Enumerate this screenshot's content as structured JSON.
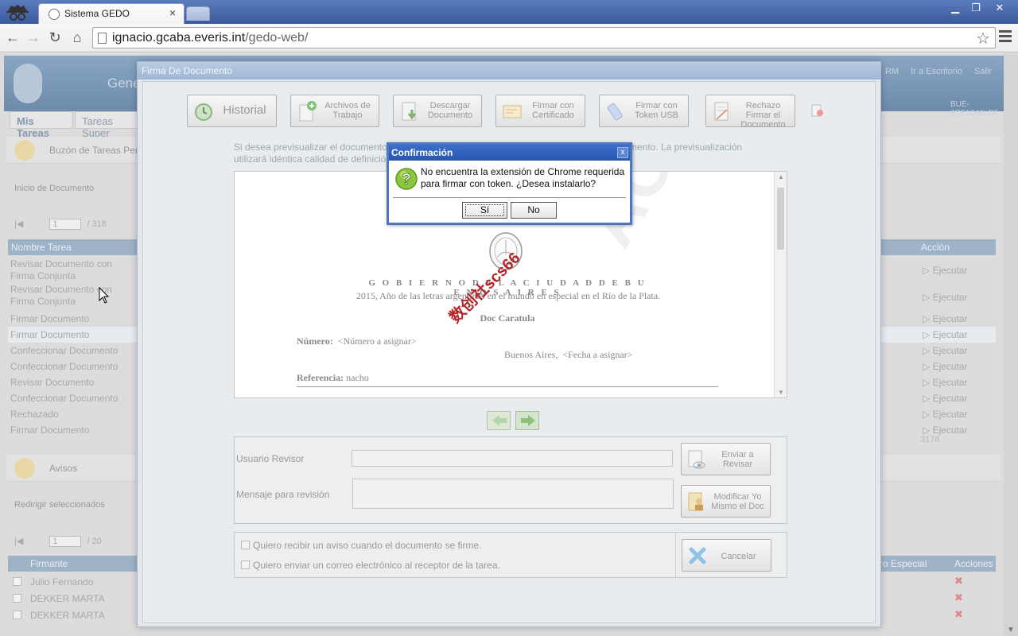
{
  "browser": {
    "tab_title": "Sistema GEDO",
    "tab_close": "×",
    "url_host": "ignacio.gcaba.everis.int",
    "url_path": "/gedo-web/",
    "win_min": "▁",
    "win_max": "❐",
    "win_close": "✕"
  },
  "app": {
    "title": "Gene",
    "user_links": [
      "RM",
      "Ir a Escritorio",
      "Salir"
    ],
    "user_code": "BUE-2CE1040LDF",
    "tabs": [
      "Mis Tareas",
      "Tareas Super"
    ],
    "buzon_title": "Buzón de Tareas Pen",
    "inicio_link": "Inicio de Documento",
    "pager1": {
      "page": "1",
      "of": "/ 318"
    },
    "task_columns": {
      "name": "Nombre Tarea",
      "action": "Acción"
    },
    "tasks": [
      {
        "name": "Revisar Documento con Firma Conjunta",
        "action": "Ejecutar"
      },
      {
        "name": "Revisar Documento con Firma Conjunta",
        "action": "Ejecutar"
      },
      {
        "name": "Firmar Documento",
        "action": "Ejecutar"
      },
      {
        "name": "Firmar Documento",
        "action": "Ejecutar"
      },
      {
        "name": "Confeccionar Documento",
        "action": "Ejecutar"
      },
      {
        "name": "Confeccionar Documento",
        "action": "Ejecutar"
      },
      {
        "name": "Revisar Documento",
        "action": "Ejecutar"
      },
      {
        "name": "Confeccionar Documento",
        "action": "Ejecutar"
      },
      {
        "name": "Rechazado",
        "action": "Ejecutar"
      },
      {
        "name": "Firmar Documento",
        "action": "Ejecutar"
      }
    ],
    "task_total": "3178",
    "avisos_title": "Avisos",
    "redirigir": "Redirigir seleccionados",
    "pager2": {
      "page": "1",
      "of": "/ 20"
    },
    "sign_columns": {
      "firmante": "Firmante",
      "especial": "ro Especial",
      "acciones": "Acciones"
    },
    "signers": [
      "Julio Fernando",
      "DEKKER MARTA",
      "DEKKER MARTA"
    ]
  },
  "firma": {
    "title": "Firma De Documento",
    "toolbar": {
      "historial": "Historial",
      "archivos": "Archivos de Trabajo",
      "descargar": "Descargar Documento",
      "firmar_cert": "Firmar con Certificado",
      "firmar_token": "Firmar con Token USB",
      "rechazo": "Rechazo Firmar el Documento"
    },
    "preview_info_1": "Si desea previsualizar el documento",
    "preview_info_1b": "con definición de imagen pulse el botón Descargar Documento. La previsualización",
    "preview_info_2": "utilizará idéntica calidad de definición a la que se observará en el documento firmado.",
    "doc": {
      "header": "G O B I E R N O D E L A C I U D A D D E B U E N O S A I R E S",
      "motto": "2015, Año de las letras argentinas en el mundo en especial en el Río de la Plata.",
      "caratula": "Doc Caratula",
      "numero_label": "Número:",
      "numero_value": "<Número a asignar>",
      "lugar": "Buenos Aires,",
      "fecha": "<Fecha a asignar>",
      "referencia_label": "Referencia:",
      "referencia_value": "nacho",
      "watermark": "ACIÓN",
      "stamp": "数创社scs66"
    },
    "revisor_label": "Usuario Revisor",
    "mensaje_label": "Mensaje para revisión",
    "enviar": "Enviar a Revisar",
    "modificar": "Modificar Yo Mismo el Doc",
    "chk_aviso": "Quiero recibir un aviso cuando el documento se firme.",
    "chk_correo": "Quiero enviar un correo electrónico al receptor de la tarea.",
    "cancelar": "Cancelar"
  },
  "confirm": {
    "title": "Confirmación",
    "close": "x",
    "message": "No encuentra la extensión de Chrome requerida para firmar con token. ¿Desea instalarlo?",
    "yes": "Sí",
    "no": "No"
  }
}
